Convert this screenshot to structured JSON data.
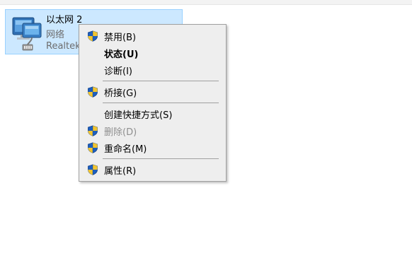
{
  "adapter": {
    "name": "以太网 2",
    "status": "网络",
    "device": "Realtek"
  },
  "context_menu": {
    "items": [
      {
        "label": "禁用(B)",
        "icon": "uac-shield-icon",
        "state": "normal"
      },
      {
        "label": "状态(U)",
        "icon": "",
        "state": "default"
      },
      {
        "label": "诊断(I)",
        "icon": "",
        "state": "normal"
      },
      {
        "label": "桥接(G)",
        "icon": "uac-shield-icon",
        "state": "normal"
      },
      {
        "label": "创建快捷方式(S)",
        "icon": "",
        "state": "normal"
      },
      {
        "label": "删除(D)",
        "icon": "uac-shield-icon",
        "state": "disabled"
      },
      {
        "label": "重命名(M)",
        "icon": "uac-shield-icon",
        "state": "normal"
      },
      {
        "label": "属性(R)",
        "icon": "uac-shield-icon",
        "state": "normal"
      }
    ]
  },
  "colors": {
    "selection_bg": "#cce8ff",
    "selection_border": "#99d1ff",
    "menu_bg": "#eeeeee",
    "disabled_text": "#8f8f8f"
  }
}
